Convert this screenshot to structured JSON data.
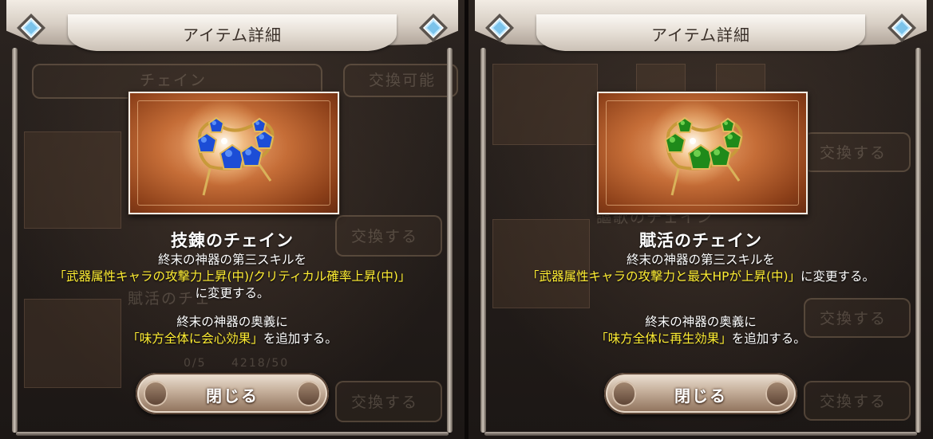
{
  "dialogs": [
    {
      "title": "アイテム詳細",
      "item_name": "技錬のチェイン",
      "gem_color": "#1c4dd6",
      "gem_highlight": "#6aa0ff",
      "desc1_plain": "終末の神器の第三スキルを",
      "desc1_highlight": "「武器属性キャラの攻撃力上昇(中)/クリティカル確率上昇(中)」",
      "desc1_suffix": "に変更する。",
      "desc2_plain": "終末の神器の奥義に",
      "desc2_highlight": "「味方全体に会心効果」",
      "desc2_suffix": "を追加する。",
      "close_label": "閉じる",
      "background": {
        "tab_label": "チェイン",
        "exchangeable_label": "交換可能",
        "exchange_label_1": "交換する",
        "exchange_label_2": "交換する",
        "item_label": "賦活のチェ",
        "count_a": "0/5",
        "count_b": "4218/50"
      }
    },
    {
      "title": "アイテム詳細",
      "item_name": "賦活のチェイン",
      "gem_color": "#1f8a1a",
      "gem_highlight": "#7fe05a",
      "desc1_plain": "終末の神器の第三スキルを",
      "desc1_highlight": "「武器属性キャラの攻撃力と最大HPが上昇(中)」",
      "desc1_suffix": "に変更する。",
      "desc2_plain": "終末の神器の奥義に",
      "desc2_highlight": "「味方全体に再生効果」",
      "desc2_suffix": "を追加する。",
      "close_label": "閉じる",
      "background": {
        "exchange_label_1": "交換する",
        "item_label": "謳歌のチェイン",
        "exchange_label_2": "交換する",
        "exchange_label_3": "交換する"
      }
    }
  ]
}
